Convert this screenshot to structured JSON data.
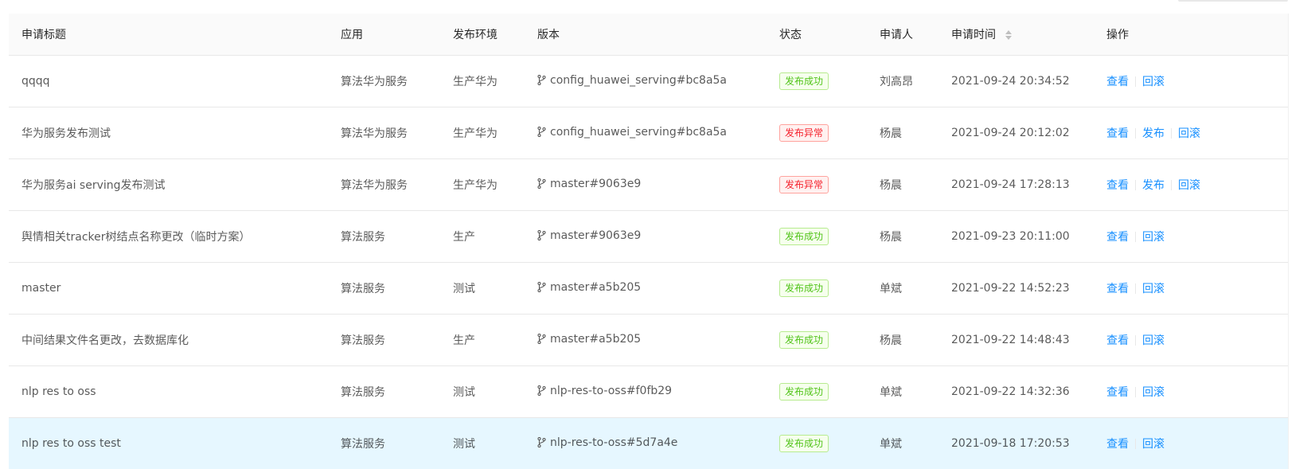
{
  "columns": [
    "申请标题",
    "应用",
    "发布环境",
    "版本",
    "状态",
    "申请人",
    "申请时间",
    "操作"
  ],
  "colors": {
    "link": "#1890ff",
    "success": "#52c41a",
    "error": "#f5222d",
    "highlight_row": "#e6f7ff"
  },
  "rows": [
    {
      "title": "qqqq",
      "app": "算法华为服务",
      "env": "生产华为",
      "version": "config_huawei_serving#bc8a5a",
      "status": "发布成功",
      "status_type": "success",
      "applicant": "刘高昂",
      "time": "2021-09-24 20:34:52",
      "actions": [
        "查看",
        "回滚"
      ]
    },
    {
      "title": "华为服务发布测试",
      "app": "算法华为服务",
      "env": "生产华为",
      "version": "config_huawei_serving#bc8a5a",
      "status": "发布异常",
      "status_type": "error",
      "applicant": "杨晨",
      "time": "2021-09-24 20:12:02",
      "actions": [
        "查看",
        "发布",
        "回滚"
      ]
    },
    {
      "title": "华为服务ai serving发布测试",
      "app": "算法华为服务",
      "env": "生产华为",
      "version": "master#9063e9",
      "status": "发布异常",
      "status_type": "error",
      "applicant": "杨晨",
      "time": "2021-09-24 17:28:13",
      "actions": [
        "查看",
        "发布",
        "回滚"
      ]
    },
    {
      "title": "舆情相关tracker树结点名称更改（临时方案）",
      "app": "算法服务",
      "env": "生产",
      "version": "master#9063e9",
      "status": "发布成功",
      "status_type": "success",
      "applicant": "杨晨",
      "time": "2021-09-23 20:11:00",
      "actions": [
        "查看",
        "回滚"
      ]
    },
    {
      "title": "master",
      "app": "算法服务",
      "env": "测试",
      "version": "master#a5b205",
      "status": "发布成功",
      "status_type": "success",
      "applicant": "单斌",
      "time": "2021-09-22 14:52:23",
      "actions": [
        "查看",
        "回滚"
      ]
    },
    {
      "title": "中间结果文件名更改，去数据库化",
      "app": "算法服务",
      "env": "生产",
      "version": "master#a5b205",
      "status": "发布成功",
      "status_type": "success",
      "applicant": "杨晨",
      "time": "2021-09-22 14:48:43",
      "actions": [
        "查看",
        "回滚"
      ]
    },
    {
      "title": "nlp res to oss",
      "app": "算法服务",
      "env": "测试",
      "version": "nlp-res-to-oss#f0fb29",
      "status": "发布成功",
      "status_type": "success",
      "applicant": "单斌",
      "time": "2021-09-22 14:32:36",
      "actions": [
        "查看",
        "回滚"
      ]
    },
    {
      "title": "nlp res to oss test",
      "app": "算法服务",
      "env": "测试",
      "version": "nlp-res-to-oss#5d7a4e",
      "status": "发布成功",
      "status_type": "success",
      "applicant": "单斌",
      "time": "2021-09-18 17:20:53",
      "actions": [
        "查看",
        "回滚"
      ],
      "highlighted": true
    }
  ]
}
